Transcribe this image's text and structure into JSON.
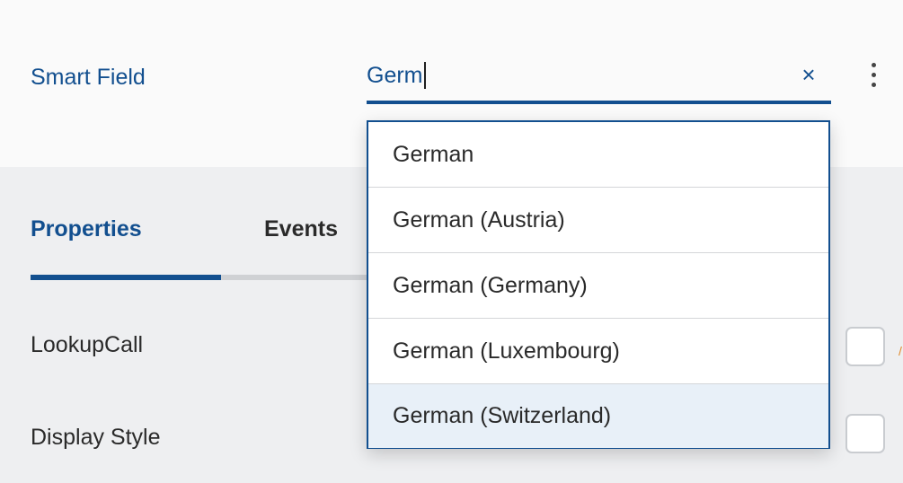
{
  "smart_field": {
    "label": "Smart Field",
    "value": "Germ",
    "clear_icon": "×",
    "menu_icon": "vertical-ellipsis-icon",
    "accent_color": "#124f8f"
  },
  "tabs": [
    {
      "label": "Properties",
      "active": true
    },
    {
      "label": "Events",
      "active": false
    }
  ],
  "properties": [
    {
      "label": "LookupCall",
      "checked": false
    },
    {
      "label": "Display Style",
      "checked": false
    }
  ],
  "dropdown": {
    "options": [
      {
        "label": "German",
        "selected": false
      },
      {
        "label": "German (Austria)",
        "selected": false
      },
      {
        "label": "German (Germany)",
        "selected": false
      },
      {
        "label": "German (Luxembourg)",
        "selected": false
      },
      {
        "label": "German (Switzerland)",
        "selected": true
      }
    ],
    "selected_background": "#e8f0f8"
  }
}
